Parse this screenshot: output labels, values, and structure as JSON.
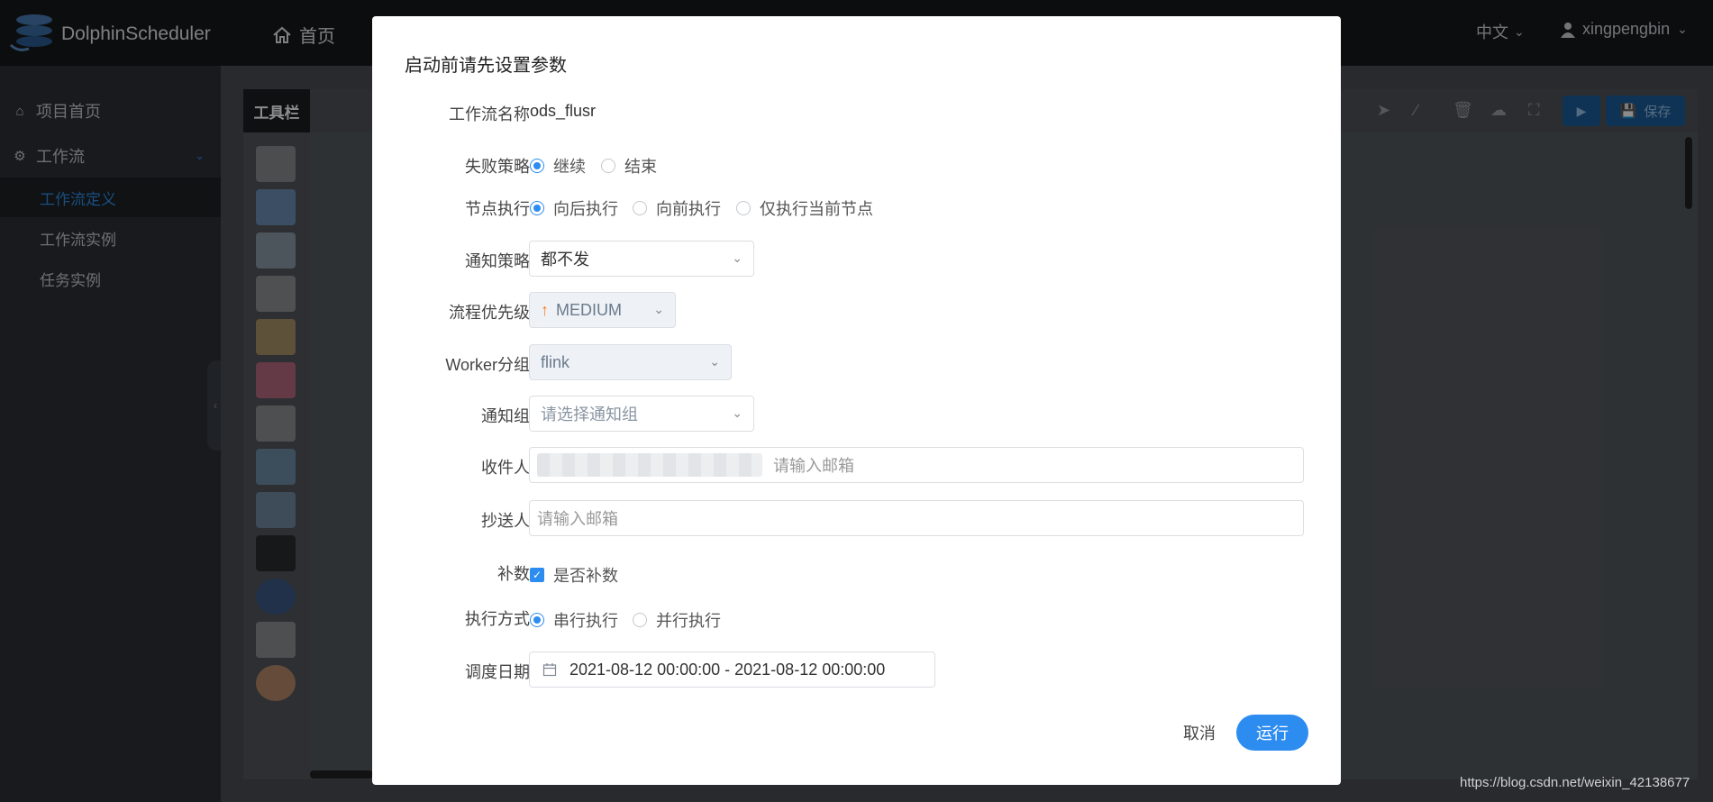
{
  "header": {
    "app_name": "DolphinScheduler",
    "nav_home": "首页",
    "language": "中文",
    "username": "xingpengbin"
  },
  "sidebar": {
    "items": [
      {
        "label": "项目首页",
        "icon": "home-icon"
      },
      {
        "label": "工作流",
        "icon": "gear-icon"
      },
      {
        "label": "工作流定义",
        "active": true
      },
      {
        "label": "工作流实例"
      },
      {
        "label": "任务实例"
      }
    ]
  },
  "toolbar": {
    "title": "工具栏",
    "save_label": "保存"
  },
  "tools": [
    "shell",
    "sub-process",
    "procedure",
    "sql",
    "spark",
    "flink",
    "mr",
    "python",
    "dependent",
    "http",
    "datax",
    "sqoop",
    "conditions"
  ],
  "dialog": {
    "title": "启动前请先设置参数",
    "workflow_name_label": "工作流名称",
    "workflow_name": "ods_flusr",
    "failure_strategy_label": "失败策略",
    "failure_strategy_options": [
      "继续",
      "结束"
    ],
    "failure_strategy_selected": "继续",
    "node_exec_label": "节点执行",
    "node_exec_options": [
      "向后执行",
      "向前执行",
      "仅执行当前节点"
    ],
    "node_exec_selected": "向后执行",
    "notify_strategy_label": "通知策略",
    "notify_strategy_value": "都不发",
    "priority_label": "流程优先级",
    "priority_value": "MEDIUM",
    "worker_group_label": "Worker分组",
    "worker_group_value": "flink",
    "notify_group_label": "通知组",
    "notify_group_placeholder": "请选择通知组",
    "receiver_label": "收件人",
    "receiver_placeholder": "请输入邮箱",
    "cc_label": "抄送人",
    "cc_placeholder": "请输入邮箱",
    "complement_label": "补数",
    "complement_checkbox": "是否补数",
    "complement_checked": true,
    "exec_mode_label": "执行方式",
    "exec_mode_options": [
      "串行执行",
      "并行执行"
    ],
    "exec_mode_selected": "串行执行",
    "schedule_date_label": "调度日期",
    "schedule_date_value": "2021-08-12 00:00:00 - 2021-08-12 00:00:00",
    "cancel_label": "取消",
    "run_label": "运行"
  },
  "watermark": "https://blog.csdn.net/weixin_42138677",
  "colors": {
    "accent": "#2d8cf0",
    "priority": "#ff7d1a"
  }
}
